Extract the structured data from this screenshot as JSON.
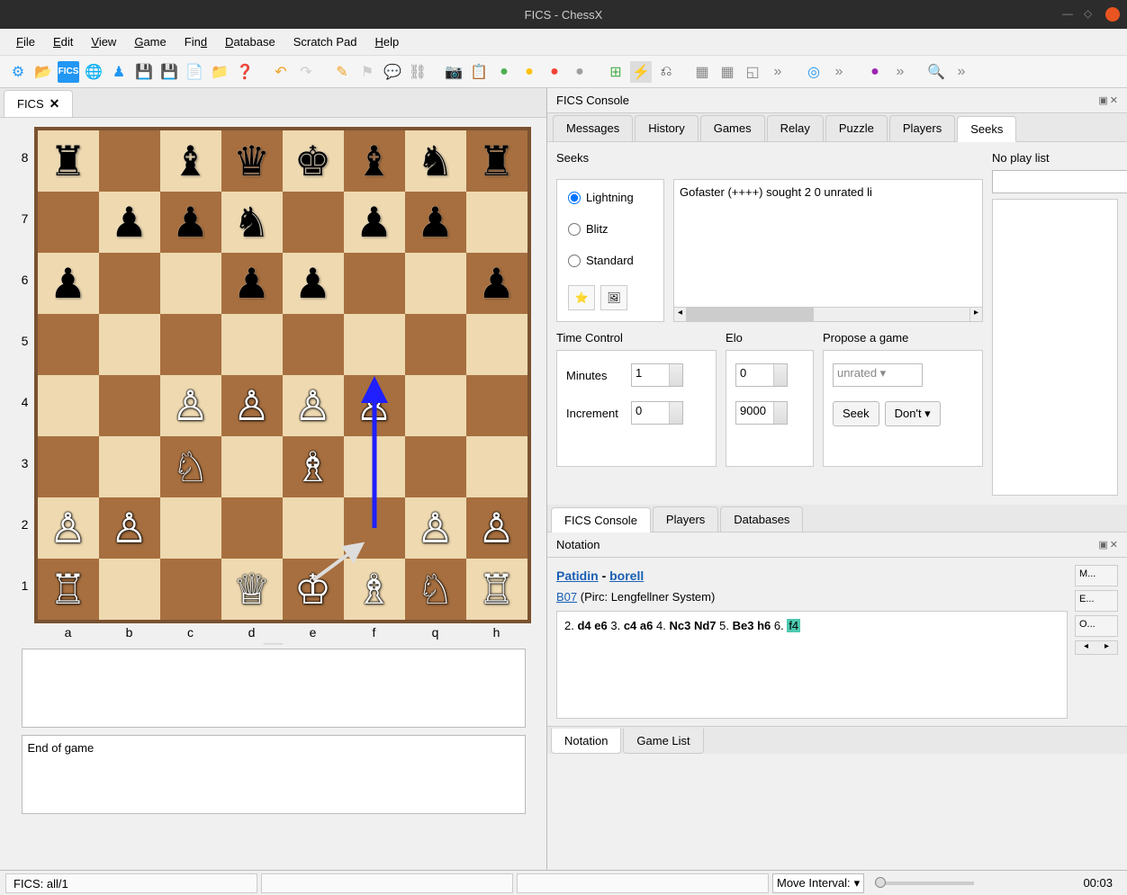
{
  "title": "FICS - ChessX",
  "menu": [
    "File",
    "Edit",
    "View",
    "Game",
    "Find",
    "Database",
    "Scratch Pad",
    "Help"
  ],
  "leftTab": "FICS",
  "ranks": [
    "8",
    "7",
    "6",
    "5",
    "4",
    "3",
    "2",
    "1"
  ],
  "files": [
    "a",
    "b",
    "c",
    "d",
    "e",
    "f",
    "q",
    "h"
  ],
  "endOfGame": "End of game",
  "ficsConsole": "FICS Console",
  "ficsTabs": [
    "Messages",
    "History",
    "Games",
    "Relay",
    "Puzzle",
    "Players",
    "Seeks"
  ],
  "seeksLabel": "Seeks",
  "noPlayLabel": "No play list",
  "seekTypes": {
    "lightning": "Lightning",
    "blitz": "Blitz",
    "standard": "Standard"
  },
  "seekEntry": "Gofaster (++++) sought 2 0 unrated li",
  "timeControlLabel": "Time Control",
  "eloLabel": "Elo",
  "proposeLabel": "Propose a game",
  "minutesLabel": "Minutes",
  "incrementLabel": "Increment",
  "minutesVal": "1",
  "incrementVal": "0",
  "eloLow": "0",
  "eloHigh": "9000",
  "rated": "unrated",
  "seekBtn": "Seek",
  "dontBtn": "Don't",
  "subTabs": [
    "FICS Console",
    "Players",
    "Databases"
  ],
  "notationLabel": "Notation",
  "player1": "Patidin",
  "player2": "borell",
  "eco": "B07",
  "opening": "(Pirc: Lengfellner System)",
  "movesPrefix": "2.",
  "moves": [
    {
      "n": "2.",
      "w": "d4",
      "b": "e6"
    },
    {
      "n": "3.",
      "w": "c4",
      "b": "a6"
    },
    {
      "n": "4.",
      "w": "Nc3",
      "b": "Nd7"
    },
    {
      "n": "5.",
      "w": "Be3",
      "b": "h6"
    },
    {
      "n": "6.",
      "w": "f4",
      "b": ""
    }
  ],
  "sideLabels": [
    "M...",
    "E...",
    "O..."
  ],
  "bottomTabs": [
    "Notation",
    "Game List"
  ],
  "status": "FICS: all/1",
  "moveInterval": "Move Interval:",
  "clock": "00:03",
  "board": [
    [
      "r",
      ".",
      "b",
      "q",
      "k",
      "b",
      "n",
      "r"
    ],
    [
      ".",
      "p",
      "p",
      "n",
      ".",
      "p",
      "p",
      "."
    ],
    [
      "p",
      ".",
      ".",
      "p",
      "p",
      ".",
      ".",
      "p"
    ],
    [
      ".",
      ".",
      ".",
      ".",
      ".",
      ".",
      ".",
      "."
    ],
    [
      ".",
      ".",
      "P",
      "P",
      "P",
      "P",
      ".",
      "."
    ],
    [
      ".",
      ".",
      "N",
      ".",
      "B",
      ".",
      ".",
      "."
    ],
    [
      "P",
      "P",
      ".",
      ".",
      ".",
      ".",
      "P",
      "P"
    ],
    [
      "R",
      ".",
      ".",
      "Q",
      "K",
      "B",
      "N",
      "R"
    ]
  ]
}
